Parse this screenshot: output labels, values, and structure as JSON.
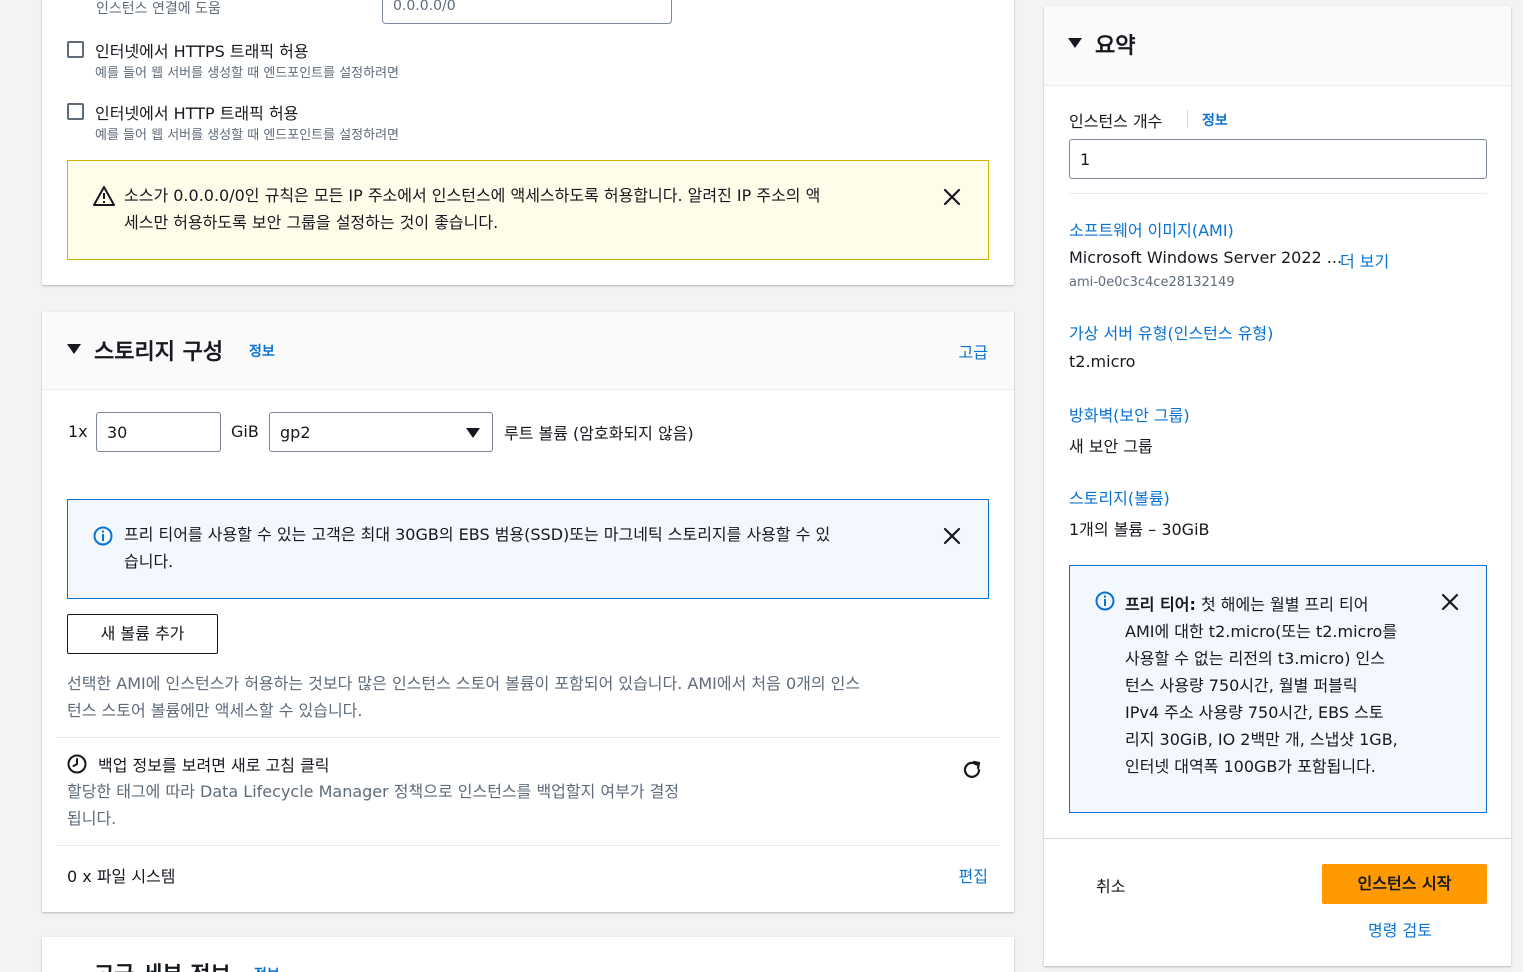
{
  "network": {
    "cut_label": "인스턴스 연결에 도움",
    "source_input_value": "0.0.0.0/0",
    "https": {
      "label": "인터넷에서 HTTPS 트래픽 허용",
      "description": "예를 들어 웹 서버를 생성할 때 엔드포인트를 설정하려면"
    },
    "http": {
      "label": "인터넷에서 HTTP 트래픽 허용",
      "description": "예를 들어 웹 서버를 생성할 때 엔드포인트를 설정하려면"
    },
    "warning": {
      "line1": "소스가 0.0.0.0/0인 규칙은 모든 IP 주소에서 인스턴스에 액세스하도록 허용합니다. 알려진 IP 주소의 액",
      "line2": "세스만 허용하도록 보안 그룹을 설정하는 것이 좋습니다."
    }
  },
  "storage": {
    "title": "스토리지 구성",
    "info": "정보",
    "advanced": "고급",
    "multiplier": "1x",
    "size_value": "30",
    "unit": "GiB",
    "volume_type": "gp2",
    "root_volume_label": "루트 볼륨 (암호화되지 않음)",
    "free_tier_info": {
      "line1": "프리 티어를 사용할 수 있는 고객은 최대 30GB의 EBS 범용(SSD)또는 마그네틱 스토리지를 사용할 수 있",
      "line2": "습니다."
    },
    "add_volume": "새 볼륨 추가",
    "ami_note": {
      "line1": "선택한 AMI에 인스턴스가 허용하는 것보다 많은 인스턴스 스토어 볼륨이 포함되어 있습니다. AMI에서 처음 0개의 인스",
      "line2": "턴스 스토어 볼륨에만 액세스할 수 있습니다."
    },
    "backup": {
      "title": "백업 정보를 보려면 새로 고침 클릭",
      "desc1": "할당한 태그에 따라 Data Lifecycle Manager 정책으로 인스턴스를 백업할지 여부가 결정",
      "desc2": "됩니다."
    },
    "filesystems": "0 x 파일 시스템",
    "edit": "편집"
  },
  "advanced_section": {
    "title": "고급 세부 정보",
    "info": "정보"
  },
  "summary": {
    "title": "요약",
    "instance_count_label": "인스턴스 개수",
    "instance_count_info": "정보",
    "instance_count_value": "1",
    "ami_label": "소프트웨어 이미지(AMI)",
    "ami_name": "Microsoft Windows Server 2022 ...",
    "ami_more": "더 보기",
    "ami_id": "ami-0e0c3c4ce28132149",
    "instance_type_label": "가상 서버 유형(인스턴스 유형)",
    "instance_type_value": "t2.micro",
    "firewall_label": "방화벽(보안 그룹)",
    "firewall_value": "새 보안 그룹",
    "storage_label": "스토리지(볼륨)",
    "storage_value": "1개의 볼륨 – 30GiB",
    "free_tier": {
      "bold": "프리 티어:",
      "line1": " 첫 해에는 월별 프리 티어",
      "line2": "AMI에 대한 t2.micro(또는 t2.micro를",
      "line3": "사용할 수 없는 리전의 t3.micro) 인스",
      "line4": "턴스 사용량 750시간, 월별 퍼블릭",
      "line5": "IPv4 주소 사용량 750시간, EBS 스토",
      "line6": "리지 30GiB, IO 2백만 개, 스냅샷 1GB,",
      "line7": "인터넷 대역폭 100GB가 포함됩니다."
    },
    "cancel": "취소",
    "launch": "인스턴스 시작",
    "review_commands": "명령 검토"
  },
  "colors": {
    "link": "#0972d3",
    "primary_button": "#ff9900",
    "warning_border": "#d8b400",
    "warning_bg": "#fffce9",
    "info_border": "#0972d3",
    "info_bg": "#f2f8fd"
  }
}
